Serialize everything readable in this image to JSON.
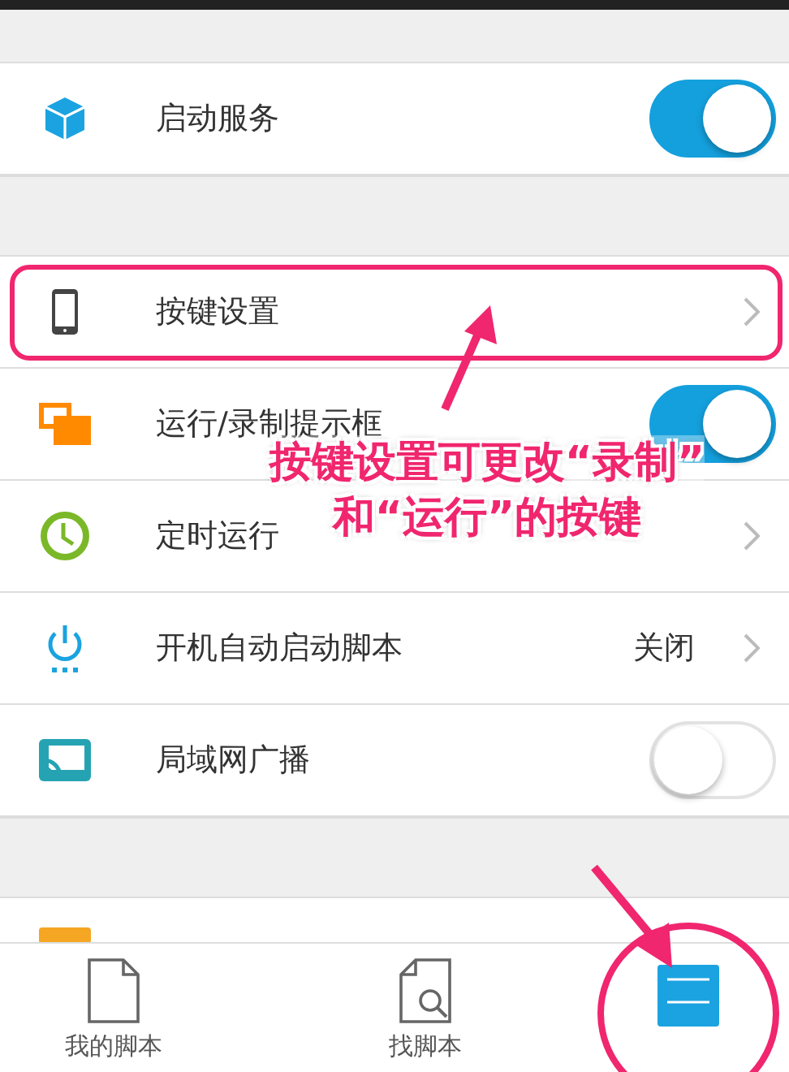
{
  "settings_groups": [
    {
      "items": [
        {
          "kind": "toggle",
          "label": "启动服务",
          "on": true
        }
      ]
    },
    {
      "items": [
        {
          "kind": "link",
          "label": "按键设置",
          "highlighted": true
        },
        {
          "kind": "toggle",
          "label": "运行/录制提示框",
          "on": true
        },
        {
          "kind": "link",
          "label": "定时运行"
        },
        {
          "kind": "link",
          "label": "开机自动启动脚本",
          "value": "关闭"
        },
        {
          "kind": "toggle",
          "label": "局域网广播",
          "on": false
        }
      ]
    },
    {
      "items": [
        {
          "kind": "partial"
        }
      ]
    }
  ],
  "annotation": {
    "lines": [
      "按键设置可更改“录制”",
      "和“运行”的按键"
    ]
  },
  "bottom_nav": [
    {
      "label": "我的脚本",
      "selected": false
    },
    {
      "label": "找脚本",
      "selected": false
    },
    {
      "selected": true,
      "circled": true
    }
  ]
}
